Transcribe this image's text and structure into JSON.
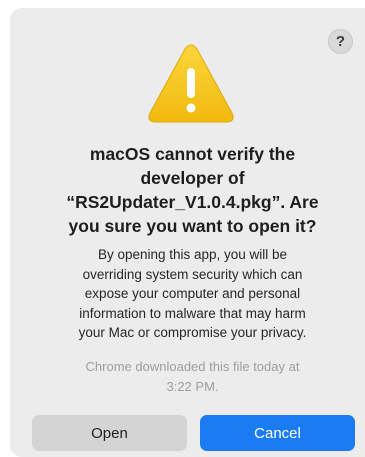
{
  "dialog": {
    "help_label": "?",
    "icon": "warning-icon",
    "title_lines": [
      "macOS cannot verify the",
      "developer of",
      "“RS2Updater_V1.0.4.pkg”. Are",
      "you sure you want to open it?"
    ],
    "body_lines": [
      "By opening this app, you will be",
      "overriding system security which can",
      "expose your computer and personal",
      "information to malware that may harm",
      "your Mac or compromise your privacy."
    ],
    "note_lines": [
      "Chrome downloaded this file today at",
      "3:22 PM."
    ],
    "buttons": {
      "open_label": "Open",
      "cancel_label": "Cancel"
    }
  },
  "colors": {
    "dialog_background": "#ececec",
    "accent": "#1a7bf2",
    "warning_yellow": "#f7c51e",
    "secondary_button": "#d4d4d4"
  }
}
